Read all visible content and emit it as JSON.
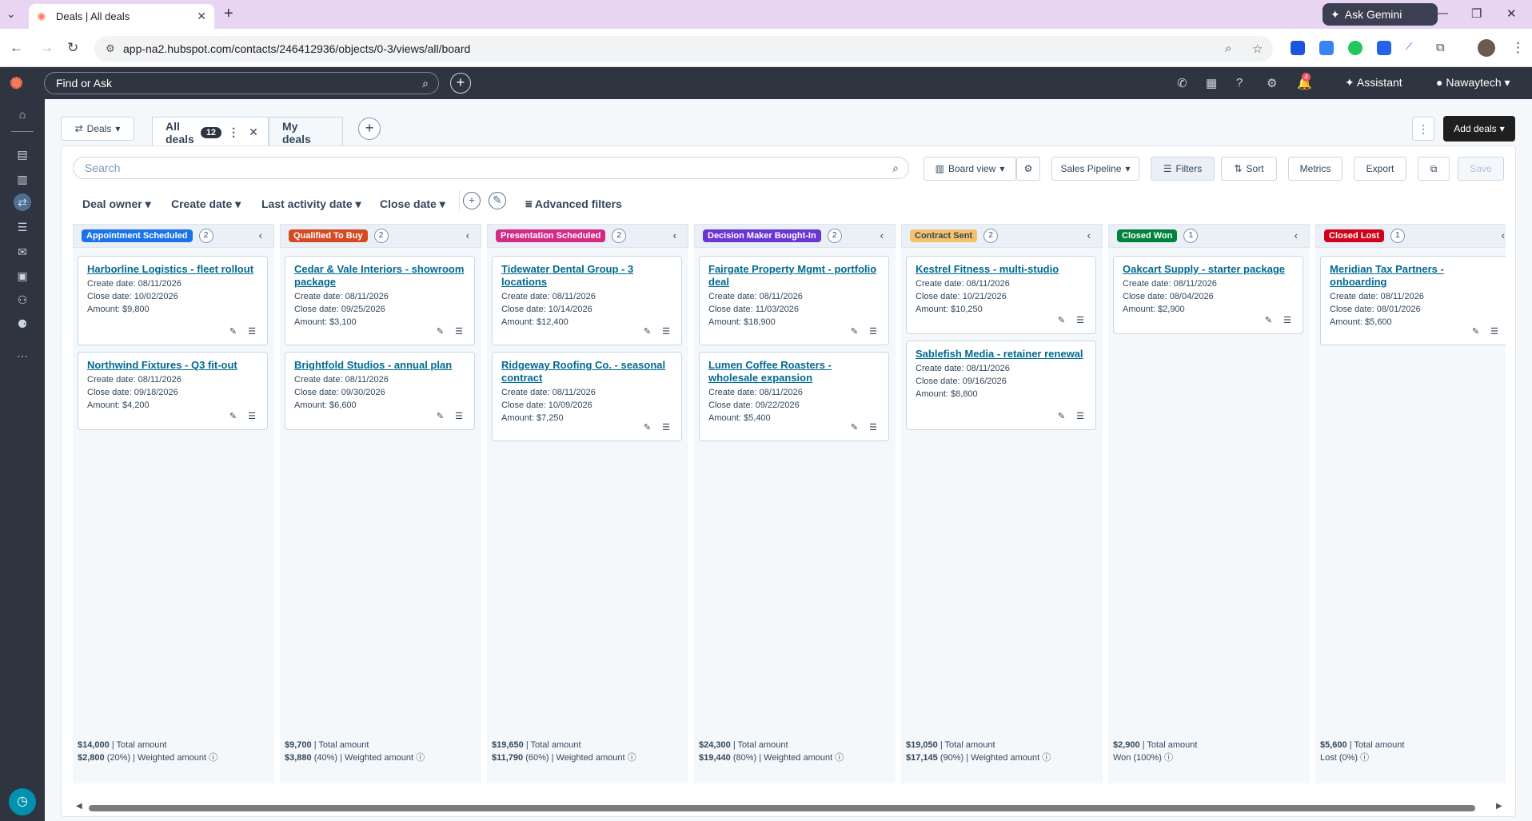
{
  "browser": {
    "tab_title": "Deals | All deals",
    "url": "app-na2.hubspot.com/contacts/246412936/objects/0-3/views/all/board",
    "ask_gemini": "Ask Gemini"
  },
  "topbar": {
    "find_placeholder": "Find or Ask",
    "notification_count": "4",
    "assistant": "Assistant",
    "account": "Nawaytech"
  },
  "header": {
    "object_label": "Deals",
    "views": [
      {
        "label": "All deals",
        "count": "12"
      },
      {
        "label": "My deals"
      }
    ],
    "add_deals": "Add deals"
  },
  "toolbar": {
    "search_placeholder": "Search",
    "board_view": "Board view",
    "pipeline": "Sales Pipeline",
    "filters": "Filters",
    "sort": "Sort",
    "metrics": "Metrics",
    "export": "Export",
    "save": "Save"
  },
  "filters": {
    "deal_owner": "Deal owner",
    "create_date": "Create date",
    "last_activity_date": "Last activity date",
    "close_date": "Close date",
    "advanced_filters": "Advanced filters"
  },
  "colors": {
    "appointment": "#1a73e8",
    "qualified": "#d54a22",
    "presentation": "#d42a86",
    "decision": "#6a35d4",
    "contract": "#f5c26b",
    "won": "#00823d",
    "lost": "#d0021b"
  },
  "columns": [
    {
      "stage": "Appointment Scheduled",
      "count": "2",
      "cards": [
        {
          "title": "Harborline Logistics - fleet rollout",
          "create": "Create date: 08/11/2026",
          "close": "Close date: 10/02/2026",
          "amount": "Amount: $9,800"
        },
        {
          "title": "Northwind Fixtures - Q3 fit-out",
          "create": "Create date: 08/11/2026",
          "close": "Close date: 09/18/2026",
          "amount": "Amount: $4,200"
        }
      ],
      "total": "$14,000",
      "total_label": "| Total amount",
      "weighted": "$2,800",
      "weighted_label": "(20%) | Weighted amount ⓘ"
    },
    {
      "stage": "Qualified To Buy",
      "count": "2",
      "cards": [
        {
          "title": "Cedar & Vale Interiors - showroom package",
          "create": "Create date: 08/11/2026",
          "close": "Close date: 09/25/2026",
          "amount": "Amount: $3,100"
        },
        {
          "title": "Brightfold Studios - annual plan",
          "create": "Create date: 08/11/2026",
          "close": "Close date: 09/30/2026",
          "amount": "Amount: $6,600"
        }
      ],
      "total": "$9,700",
      "total_label": "| Total amount",
      "weighted": "$3,880",
      "weighted_label": "(40%) | Weighted amount ⓘ"
    },
    {
      "stage": "Presentation Scheduled",
      "count": "2",
      "cards": [
        {
          "title": "Tidewater Dental Group - 3 locations",
          "create": "Create date: 08/11/2026",
          "close": "Close date: 10/14/2026",
          "amount": "Amount: $12,400"
        },
        {
          "title": "Ridgeway Roofing Co. - seasonal contract",
          "create": "Create date: 08/11/2026",
          "close": "Close date: 10/09/2026",
          "amount": "Amount: $7,250"
        }
      ],
      "total": "$19,650",
      "total_label": "| Total amount",
      "weighted": "$11,790",
      "weighted_label": "(60%) | Weighted amount ⓘ"
    },
    {
      "stage": "Decision Maker Bought-In",
      "count": "2",
      "cards": [
        {
          "title": "Fairgate Property Mgmt - portfolio deal",
          "create": "Create date: 08/11/2026",
          "close": "Close date: 11/03/2026",
          "amount": "Amount: $18,900"
        },
        {
          "title": "Lumen Coffee Roasters - wholesale expansion",
          "create": "Create date: 08/11/2026",
          "close": "Close date: 09/22/2026",
          "amount": "Amount: $5,400"
        }
      ],
      "total": "$24,300",
      "total_label": "| Total amount",
      "weighted": "$19,440",
      "weighted_label": "(80%) | Weighted amount ⓘ"
    },
    {
      "stage": "Contract Sent",
      "count": "2",
      "cards": [
        {
          "title": "Kestrel Fitness - multi-studio",
          "create": "Create date: 08/11/2026",
          "close": "Close date: 10/21/2026",
          "amount": "Amount: $10,250"
        },
        {
          "title": "Sablefish Media - retainer renewal",
          "create": "Create date: 08/11/2026",
          "close": "Close date: 09/16/2026",
          "amount": "Amount: $8,800"
        }
      ],
      "total": "$19,050",
      "total_label": "| Total amount",
      "weighted": "$17,145",
      "weighted_label": "(90%) | Weighted amount ⓘ"
    },
    {
      "stage": "Closed Won",
      "count": "1",
      "cards": [
        {
          "title": "Oakcart Supply - starter package",
          "create": "Create date: 08/11/2026",
          "close": "Close date: 08/04/2026",
          "amount": "Amount: $2,900"
        }
      ],
      "total": "$2,900",
      "total_label": "| Total amount",
      "weighted": "",
      "weighted_label": "Won (100%) ⓘ"
    },
    {
      "stage": "Closed Lost",
      "count": "1",
      "cards": [
        {
          "title": "Meridian Tax Partners - onboarding",
          "create": "Create date: 08/11/2026",
          "close": "Close date: 08/01/2026",
          "amount": "Amount: $5,600"
        }
      ],
      "total": "$5,600",
      "total_label": "| Total amount",
      "weighted": "",
      "weighted_label": "Lost (0%) ⓘ"
    }
  ]
}
